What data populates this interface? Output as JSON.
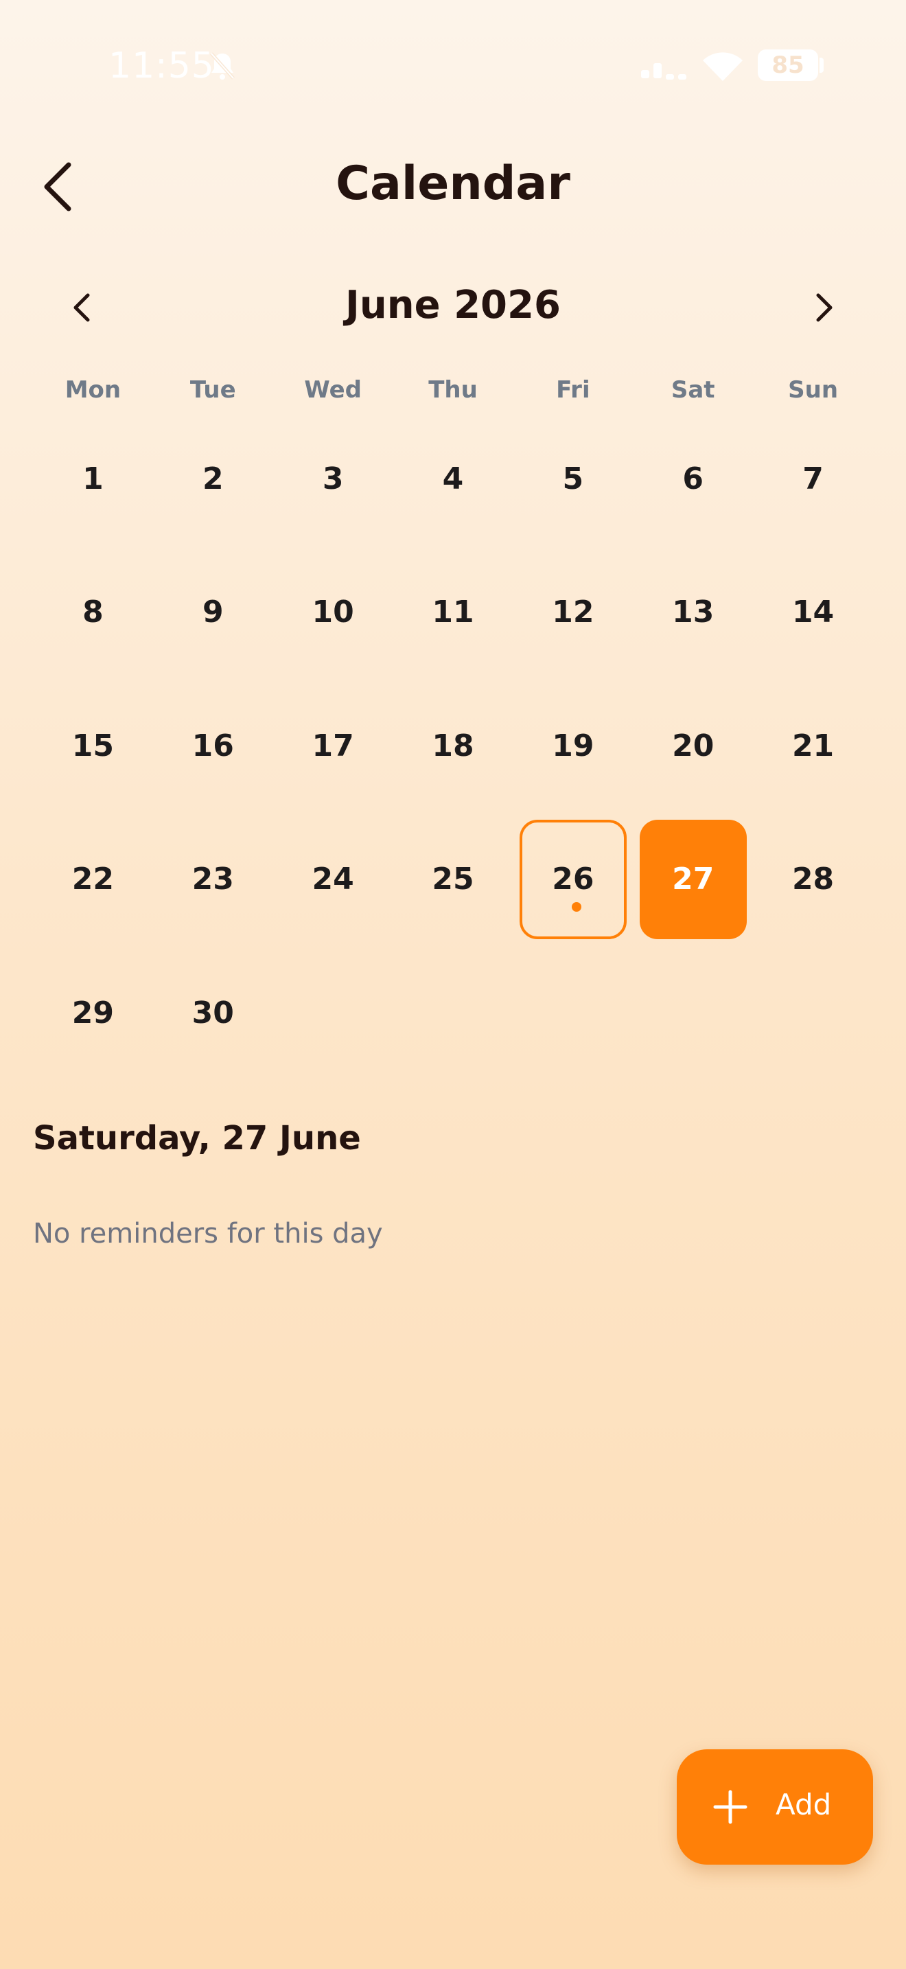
{
  "status_bar": {
    "time": "11:55",
    "battery": "85",
    "icons": [
      "bell-slash-icon",
      "signal-icon",
      "wifi-icon",
      "battery-icon"
    ]
  },
  "header": {
    "title": "Calendar",
    "back_icon": "chevron-left-icon"
  },
  "month_nav": {
    "title": "June 2026",
    "prev_icon": "chevron-left-icon",
    "next_icon": "chevron-right-icon"
  },
  "weekdays": [
    "Mon",
    "Tue",
    "Wed",
    "Thu",
    "Fri",
    "Sat",
    "Sun"
  ],
  "calendar": {
    "start_weekday_index": 0,
    "days": [
      "1",
      "2",
      "3",
      "4",
      "5",
      "6",
      "7",
      "8",
      "9",
      "10",
      "11",
      "12",
      "13",
      "14",
      "15",
      "16",
      "17",
      "18",
      "19",
      "20",
      "21",
      "22",
      "23",
      "24",
      "25",
      "26",
      "27",
      "28",
      "29",
      "30"
    ],
    "today": "26",
    "selected": "27",
    "days_with_events": [
      "26"
    ]
  },
  "selected_section": {
    "title": "Saturday, 27 June",
    "empty_message": "No reminders for this day"
  },
  "fab": {
    "label": "Add",
    "icon": "plus-icon"
  },
  "colors": {
    "accent": "#ff8008",
    "text_dark": "#24130f",
    "muted": "#6f7a88",
    "background_top": "#fdf4ea",
    "background_bottom": "#fddcb3"
  }
}
